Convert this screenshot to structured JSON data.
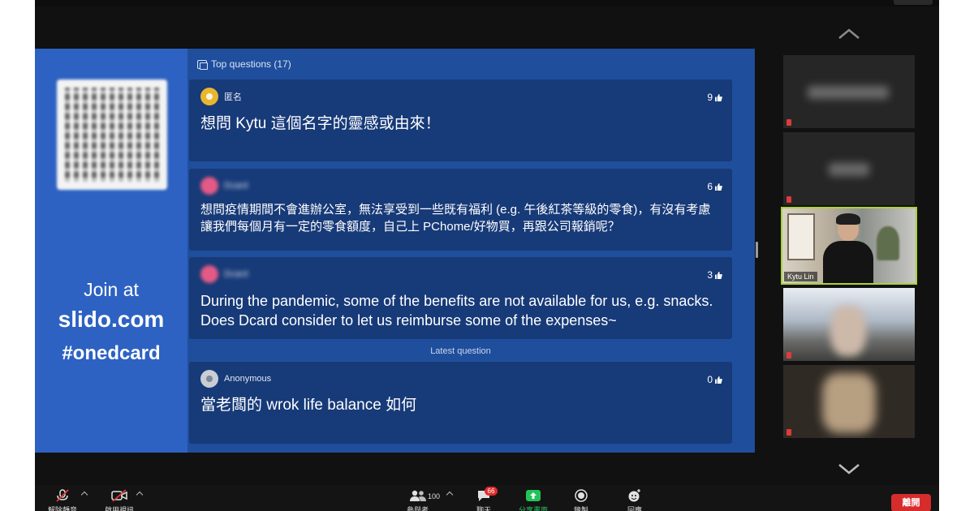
{
  "slido": {
    "section_title": "Top questions (17)",
    "join": {
      "at": "Join at",
      "url": "slido.com",
      "code": "#onedcard"
    },
    "latest_label": "Latest question",
    "questions": [
      {
        "author": "匿名",
        "likes": "9",
        "text": "想問 Kytu 這個名字的靈感或由來！"
      },
      {
        "author": "Dcard",
        "likes": "6",
        "text": "想問疫情期間不會進辦公室，無法享受到一些既有福利 (e.g. 午後紅茶等級的零食)，有沒有考慮讓我們每個月有一定的零食額度，自己上 PChome/好物買，再跟公司報銷呢？"
      },
      {
        "author": "Dcard",
        "likes": "3",
        "text": "During the pandemic, some of the benefits are not available for us, e.g. snacks. Does Dcard consider to let us reimburse some of the expenses~"
      }
    ],
    "latest": {
      "author": "Anonymous",
      "likes": "0",
      "text": "當老闆的 wrok life balance 如何"
    }
  },
  "gallery": {
    "speaker_name": "Kytu Lin"
  },
  "toolbar": {
    "mute_label": "解除靜音",
    "video_label": "啟用視訊",
    "participants_label": "參與者",
    "participants_count": "100",
    "chat_label": "聊天",
    "chat_badge": "66",
    "share_label": "分享畫面",
    "record_label": "錄製",
    "reactions_label": "回應",
    "leave_label": "離開"
  },
  "colors": {
    "slido_blue": "#1f4e9c",
    "card_blue": "#173a78",
    "speaker_border": "#a8d23c",
    "share_green": "#23c35a",
    "leave_red": "#d72c2c"
  }
}
